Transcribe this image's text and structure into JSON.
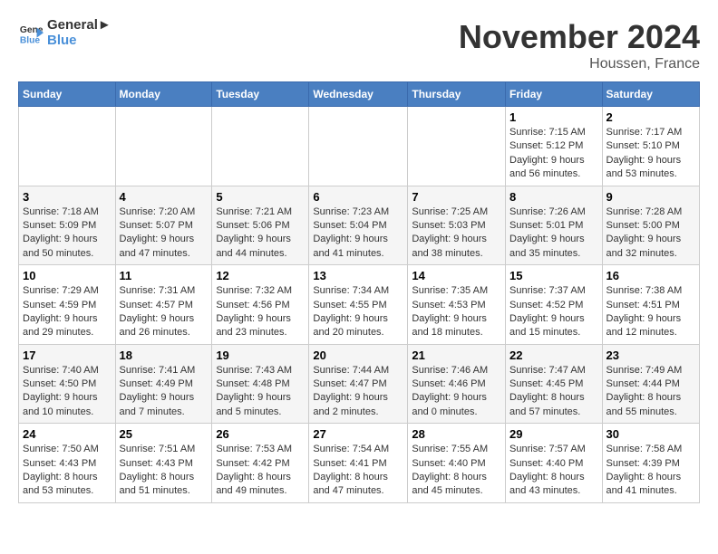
{
  "header": {
    "logo_general": "General",
    "logo_blue": "Blue",
    "month_title": "November 2024",
    "location": "Houssen, France"
  },
  "calendar": {
    "days_of_week": [
      "Sunday",
      "Monday",
      "Tuesday",
      "Wednesday",
      "Thursday",
      "Friday",
      "Saturday"
    ],
    "weeks": [
      [
        {
          "day": "",
          "detail": ""
        },
        {
          "day": "",
          "detail": ""
        },
        {
          "day": "",
          "detail": ""
        },
        {
          "day": "",
          "detail": ""
        },
        {
          "day": "",
          "detail": ""
        },
        {
          "day": "1",
          "detail": "Sunrise: 7:15 AM\nSunset: 5:12 PM\nDaylight: 9 hours and 56 minutes."
        },
        {
          "day": "2",
          "detail": "Sunrise: 7:17 AM\nSunset: 5:10 PM\nDaylight: 9 hours and 53 minutes."
        }
      ],
      [
        {
          "day": "3",
          "detail": "Sunrise: 7:18 AM\nSunset: 5:09 PM\nDaylight: 9 hours and 50 minutes."
        },
        {
          "day": "4",
          "detail": "Sunrise: 7:20 AM\nSunset: 5:07 PM\nDaylight: 9 hours and 47 minutes."
        },
        {
          "day": "5",
          "detail": "Sunrise: 7:21 AM\nSunset: 5:06 PM\nDaylight: 9 hours and 44 minutes."
        },
        {
          "day": "6",
          "detail": "Sunrise: 7:23 AM\nSunset: 5:04 PM\nDaylight: 9 hours and 41 minutes."
        },
        {
          "day": "7",
          "detail": "Sunrise: 7:25 AM\nSunset: 5:03 PM\nDaylight: 9 hours and 38 minutes."
        },
        {
          "day": "8",
          "detail": "Sunrise: 7:26 AM\nSunset: 5:01 PM\nDaylight: 9 hours and 35 minutes."
        },
        {
          "day": "9",
          "detail": "Sunrise: 7:28 AM\nSunset: 5:00 PM\nDaylight: 9 hours and 32 minutes."
        }
      ],
      [
        {
          "day": "10",
          "detail": "Sunrise: 7:29 AM\nSunset: 4:59 PM\nDaylight: 9 hours and 29 minutes."
        },
        {
          "day": "11",
          "detail": "Sunrise: 7:31 AM\nSunset: 4:57 PM\nDaylight: 9 hours and 26 minutes."
        },
        {
          "day": "12",
          "detail": "Sunrise: 7:32 AM\nSunset: 4:56 PM\nDaylight: 9 hours and 23 minutes."
        },
        {
          "day": "13",
          "detail": "Sunrise: 7:34 AM\nSunset: 4:55 PM\nDaylight: 9 hours and 20 minutes."
        },
        {
          "day": "14",
          "detail": "Sunrise: 7:35 AM\nSunset: 4:53 PM\nDaylight: 9 hours and 18 minutes."
        },
        {
          "day": "15",
          "detail": "Sunrise: 7:37 AM\nSunset: 4:52 PM\nDaylight: 9 hours and 15 minutes."
        },
        {
          "day": "16",
          "detail": "Sunrise: 7:38 AM\nSunset: 4:51 PM\nDaylight: 9 hours and 12 minutes."
        }
      ],
      [
        {
          "day": "17",
          "detail": "Sunrise: 7:40 AM\nSunset: 4:50 PM\nDaylight: 9 hours and 10 minutes."
        },
        {
          "day": "18",
          "detail": "Sunrise: 7:41 AM\nSunset: 4:49 PM\nDaylight: 9 hours and 7 minutes."
        },
        {
          "day": "19",
          "detail": "Sunrise: 7:43 AM\nSunset: 4:48 PM\nDaylight: 9 hours and 5 minutes."
        },
        {
          "day": "20",
          "detail": "Sunrise: 7:44 AM\nSunset: 4:47 PM\nDaylight: 9 hours and 2 minutes."
        },
        {
          "day": "21",
          "detail": "Sunrise: 7:46 AM\nSunset: 4:46 PM\nDaylight: 9 hours and 0 minutes."
        },
        {
          "day": "22",
          "detail": "Sunrise: 7:47 AM\nSunset: 4:45 PM\nDaylight: 8 hours and 57 minutes."
        },
        {
          "day": "23",
          "detail": "Sunrise: 7:49 AM\nSunset: 4:44 PM\nDaylight: 8 hours and 55 minutes."
        }
      ],
      [
        {
          "day": "24",
          "detail": "Sunrise: 7:50 AM\nSunset: 4:43 PM\nDaylight: 8 hours and 53 minutes."
        },
        {
          "day": "25",
          "detail": "Sunrise: 7:51 AM\nSunset: 4:43 PM\nDaylight: 8 hours and 51 minutes."
        },
        {
          "day": "26",
          "detail": "Sunrise: 7:53 AM\nSunset: 4:42 PM\nDaylight: 8 hours and 49 minutes."
        },
        {
          "day": "27",
          "detail": "Sunrise: 7:54 AM\nSunset: 4:41 PM\nDaylight: 8 hours and 47 minutes."
        },
        {
          "day": "28",
          "detail": "Sunrise: 7:55 AM\nSunset: 4:40 PM\nDaylight: 8 hours and 45 minutes."
        },
        {
          "day": "29",
          "detail": "Sunrise: 7:57 AM\nSunset: 4:40 PM\nDaylight: 8 hours and 43 minutes."
        },
        {
          "day": "30",
          "detail": "Sunrise: 7:58 AM\nSunset: 4:39 PM\nDaylight: 8 hours and 41 minutes."
        }
      ]
    ]
  }
}
